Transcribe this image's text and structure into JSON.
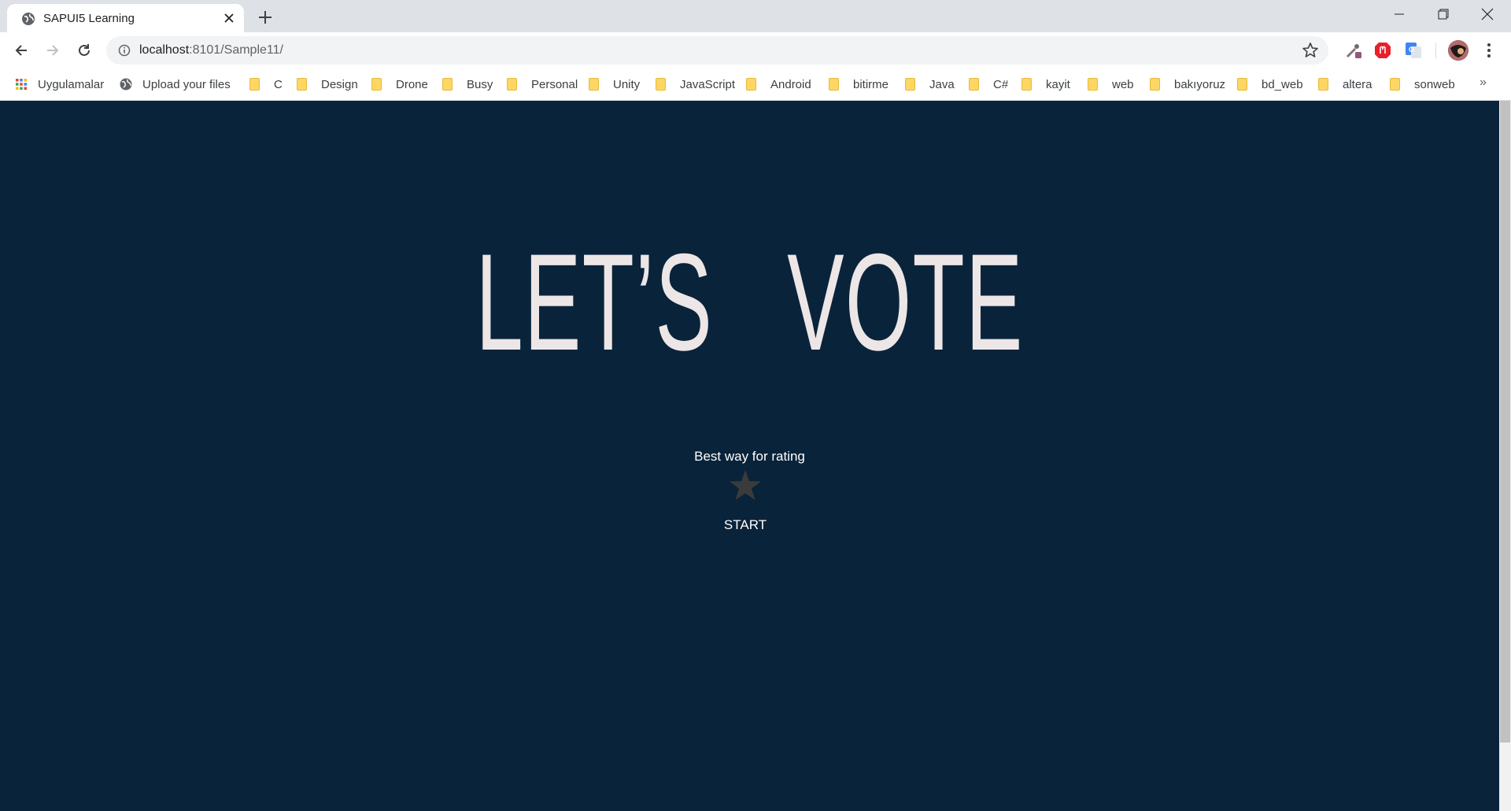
{
  "browser": {
    "tab": {
      "title": "SAPUI5 Learning"
    },
    "address": {
      "host": "localhost",
      "path": ":8101/Sample11/"
    },
    "bookmarks": [
      {
        "label": "Uygulamalar",
        "icon": "apps-grid-icon"
      },
      {
        "label": "Upload your files",
        "icon": "globe-icon"
      },
      {
        "label": "C",
        "icon": "folder-icon"
      },
      {
        "label": "Design",
        "icon": "folder-icon"
      },
      {
        "label": "Drone",
        "icon": "folder-icon"
      },
      {
        "label": "Busy",
        "icon": "folder-icon"
      },
      {
        "label": "Personal",
        "icon": "folder-icon"
      },
      {
        "label": "Unity",
        "icon": "folder-icon"
      },
      {
        "label": "JavaScript",
        "icon": "folder-icon"
      },
      {
        "label": "Android",
        "icon": "folder-icon"
      },
      {
        "label": "bitirme",
        "icon": "folder-icon"
      },
      {
        "label": "Java",
        "icon": "folder-icon"
      },
      {
        "label": "C#",
        "icon": "folder-icon"
      },
      {
        "label": "kayit",
        "icon": "folder-icon"
      },
      {
        "label": "web",
        "icon": "folder-icon"
      },
      {
        "label": "bakıyoruz",
        "icon": "folder-icon"
      },
      {
        "label": "bd_web",
        "icon": "folder-icon"
      },
      {
        "label": "altera",
        "icon": "folder-icon"
      },
      {
        "label": "sonweb",
        "icon": "folder-icon"
      }
    ],
    "more_label": "»"
  },
  "page": {
    "hero_title": "LET’S   VOTE",
    "subtitle": "Best way for rating",
    "rating_icon": "star-icon",
    "start_label": "START",
    "colors": {
      "background": "#09233a",
      "hero_text": "#ede6e6",
      "star": "#3b3b3b"
    }
  }
}
